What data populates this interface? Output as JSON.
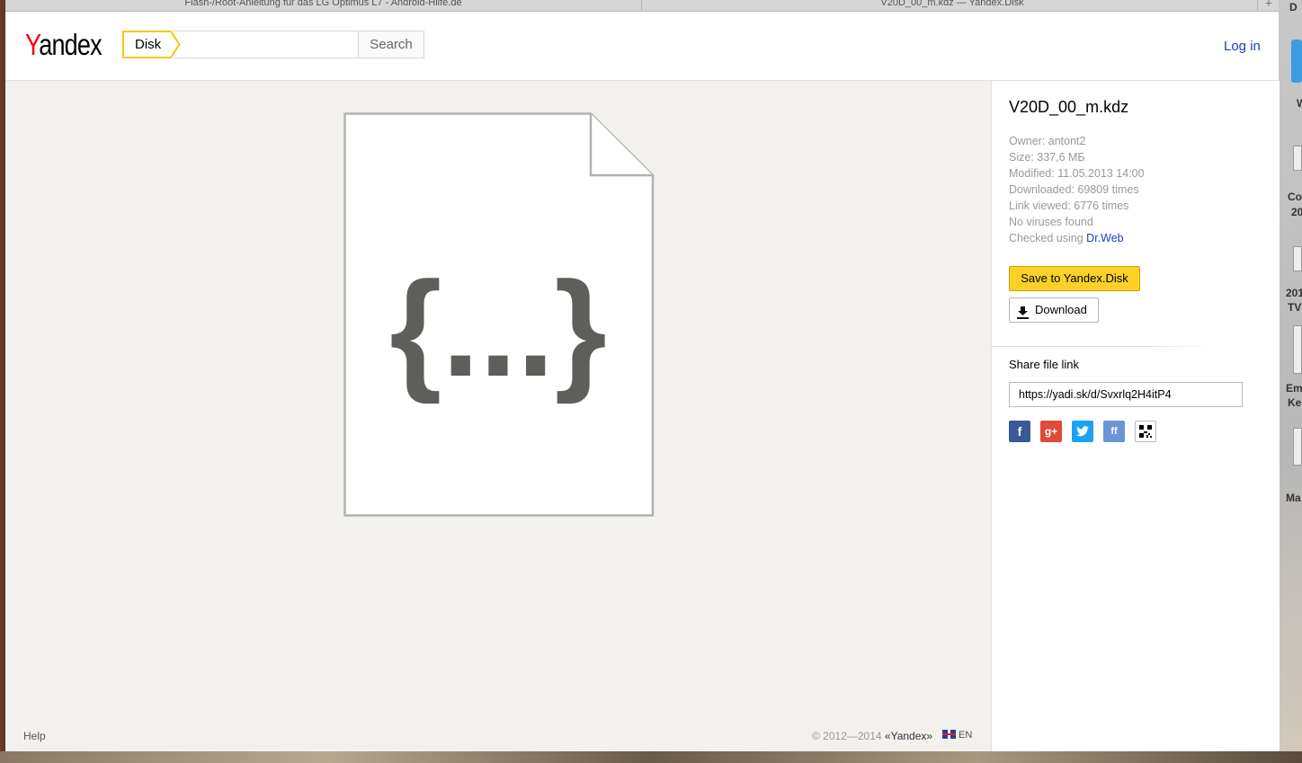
{
  "browser": {
    "tabs": [
      {
        "label": "Flash-/Root-Anleitung für das LG Optimus L7 - Android-Hilfe.de"
      },
      {
        "label": "V20D_00_m.kdz — Yandex.Disk"
      }
    ],
    "new_tab": "+"
  },
  "desktop": {
    "items": [
      "D",
      "W",
      "Co",
      "20",
      "201",
      "TV",
      "Em",
      "Ke",
      "Ma"
    ]
  },
  "header": {
    "logo": {
      "first": "Y",
      "rest": "andex"
    },
    "service": "Disk",
    "search_value": "",
    "search_button": "Search",
    "login": "Log in"
  },
  "preview": {
    "glyph": "{...}"
  },
  "file": {
    "name": "V20D_00_m.kdz",
    "owner": "Owner: antont2",
    "size": "Size: 337,6 МБ",
    "modified": "Modified: 11.05.2013 14:00",
    "downloaded": "Downloaded: 69809 times",
    "link_viewed": "Link viewed: 6776 times",
    "viruses": "No viruses found",
    "checked_prefix": "Checked using ",
    "checked_link": "Dr.Web"
  },
  "actions": {
    "save": "Save to Yandex.Disk",
    "download": "Download"
  },
  "share": {
    "label": "Share file link",
    "url": "https://yadi.sk/d/Svxrlq2H4itP4",
    "networks": [
      {
        "name": "facebook",
        "glyph": "f"
      },
      {
        "name": "google-plus",
        "glyph": "g+"
      },
      {
        "name": "twitter",
        "glyph": "t"
      },
      {
        "name": "friendfeed",
        "glyph": "ff"
      },
      {
        "name": "qr-code",
        "glyph": ""
      }
    ]
  },
  "footer": {
    "help": "Help",
    "copyright_prefix": "© 2012—2014 ",
    "copyright_brand": "«Yandex»",
    "language": "EN"
  },
  "colors": {
    "brand_red": "#ff0000",
    "accent_yellow": "#fbd128",
    "link_blue": "#1a3dc1",
    "preview_bg": "#f3f1ee"
  }
}
